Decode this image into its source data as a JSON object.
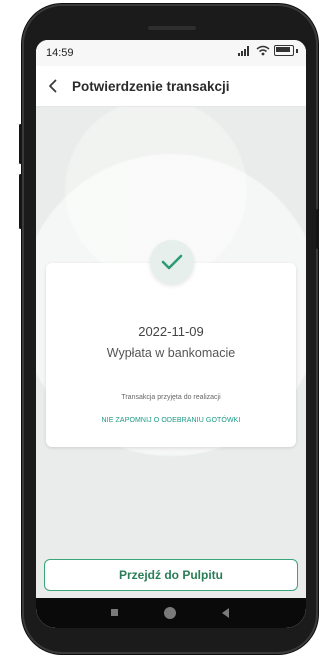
{
  "status_bar": {
    "time": "14:59",
    "icons": [
      "signal-icon",
      "wifi-icon",
      "battery-icon"
    ]
  },
  "header": {
    "back_icon": "chevron-left-icon",
    "title": "Potwierdzenie transakcji"
  },
  "confirmation": {
    "icon": "checkmark-icon",
    "date": "2022-11-09",
    "description": "Wypłata w bankomacie",
    "status_note": "Transakcja przyjęta do realizacji",
    "reminder": "NIE ZAPOMNIJ O ODEBRANIU GOTÓWKI"
  },
  "actions": {
    "dashboard_button": "Przejdź do Pulpitu"
  },
  "nav_bar": {
    "icons": [
      "recent-apps-icon",
      "home-icon",
      "back-icon"
    ]
  },
  "colors": {
    "accent": "#2a7d57",
    "reminder": "#1a9a84",
    "check": "#2e9a73"
  }
}
